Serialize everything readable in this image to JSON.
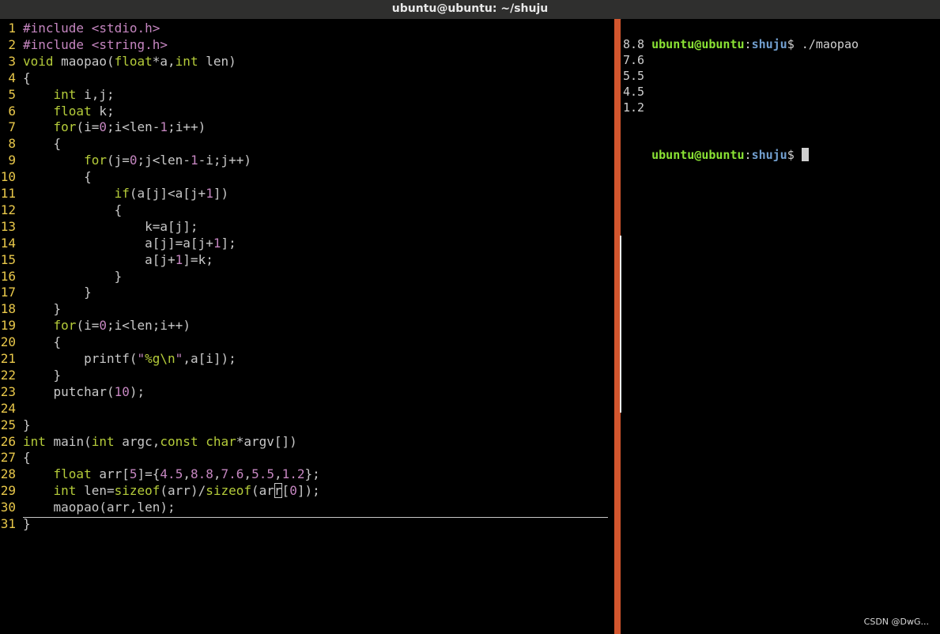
{
  "window": {
    "title": "ubuntu@ubuntu: ~/shuju"
  },
  "colors": {
    "line_number": "#e9c84a",
    "preproc": "#c586c0",
    "type_keyword": "#b5cc3a",
    "number": "#c586c0",
    "default_text": "#c8c8c8",
    "string": "#c586c0",
    "prompt_user": "#8ae234",
    "prompt_path": "#729fcf",
    "divider": "#d2562e"
  },
  "editor": {
    "lines": [
      {
        "num": "1",
        "tokens": [
          [
            "#include ",
            "pp"
          ],
          [
            "<stdio.h>",
            "st"
          ]
        ]
      },
      {
        "num": "2",
        "tokens": [
          [
            "#include ",
            "pp"
          ],
          [
            "<string.h>",
            "st"
          ]
        ]
      },
      {
        "num": "3",
        "tokens": [
          [
            "void",
            "ty"
          ],
          [
            " maopao(",
            "df"
          ],
          [
            "float",
            "ty"
          ],
          [
            "*a,",
            "df"
          ],
          [
            "int",
            "ty"
          ],
          [
            " len)",
            "df"
          ]
        ]
      },
      {
        "num": "4",
        "tokens": [
          [
            "{",
            "df"
          ]
        ]
      },
      {
        "num": "5",
        "tokens": [
          [
            "    ",
            "df"
          ],
          [
            "int",
            "ty"
          ],
          [
            " i,j;",
            "df"
          ]
        ]
      },
      {
        "num": "6",
        "tokens": [
          [
            "    ",
            "df"
          ],
          [
            "float",
            "ty"
          ],
          [
            " k;",
            "df"
          ]
        ]
      },
      {
        "num": "7",
        "tokens": [
          [
            "    ",
            "df"
          ],
          [
            "for",
            "ty"
          ],
          [
            "(i=",
            "df"
          ],
          [
            "0",
            "nu"
          ],
          [
            ";i<len-",
            "df"
          ],
          [
            "1",
            "nu"
          ],
          [
            ";i++)",
            "df"
          ]
        ]
      },
      {
        "num": "8",
        "tokens": [
          [
            "    {",
            "df"
          ]
        ]
      },
      {
        "num": "9",
        "tokens": [
          [
            "        ",
            "df"
          ],
          [
            "for",
            "ty"
          ],
          [
            "(j=",
            "df"
          ],
          [
            "0",
            "nu"
          ],
          [
            ";j<len-",
            "df"
          ],
          [
            "1",
            "nu"
          ],
          [
            "-i;j++)",
            "df"
          ]
        ]
      },
      {
        "num": "10",
        "tokens": [
          [
            "        {",
            "df"
          ]
        ]
      },
      {
        "num": "11",
        "tokens": [
          [
            "            ",
            "df"
          ],
          [
            "if",
            "ty"
          ],
          [
            "(a[j]<a[j+",
            "df"
          ],
          [
            "1",
            "nu"
          ],
          [
            "])",
            "df"
          ]
        ]
      },
      {
        "num": "12",
        "tokens": [
          [
            "            {",
            "df"
          ]
        ]
      },
      {
        "num": "13",
        "tokens": [
          [
            "                k=a[j];",
            "df"
          ]
        ]
      },
      {
        "num": "14",
        "tokens": [
          [
            "                a[j]=a[j+",
            "df"
          ],
          [
            "1",
            "nu"
          ],
          [
            "];",
            "df"
          ]
        ]
      },
      {
        "num": "15",
        "tokens": [
          [
            "                a[j+",
            "df"
          ],
          [
            "1",
            "nu"
          ],
          [
            "]=k;",
            "df"
          ]
        ]
      },
      {
        "num": "16",
        "tokens": [
          [
            "            }",
            "df"
          ]
        ]
      },
      {
        "num": "17",
        "tokens": [
          [
            "        }",
            "df"
          ]
        ]
      },
      {
        "num": "18",
        "tokens": [
          [
            "    }",
            "df"
          ]
        ]
      },
      {
        "num": "19",
        "tokens": [
          [
            "    ",
            "df"
          ],
          [
            "for",
            "ty"
          ],
          [
            "(i=",
            "df"
          ],
          [
            "0",
            "nu"
          ],
          [
            ";i<len;i++)",
            "df"
          ]
        ]
      },
      {
        "num": "20",
        "tokens": [
          [
            "    {",
            "df"
          ]
        ]
      },
      {
        "num": "21",
        "tokens": [
          [
            "        printf(",
            "df"
          ],
          [
            "\"",
            "st"
          ],
          [
            "%g\\n",
            "ty"
          ],
          [
            "\"",
            "st"
          ],
          [
            ",a[i]);",
            "df"
          ]
        ]
      },
      {
        "num": "22",
        "tokens": [
          [
            "    }",
            "df"
          ]
        ]
      },
      {
        "num": "23",
        "tokens": [
          [
            "    putchar(",
            "df"
          ],
          [
            "10",
            "nu"
          ],
          [
            ");",
            "df"
          ]
        ]
      },
      {
        "num": "24",
        "tokens": [
          [
            "",
            "df"
          ]
        ]
      },
      {
        "num": "25",
        "tokens": [
          [
            "}",
            "df"
          ]
        ]
      },
      {
        "num": "26",
        "tokens": [
          [
            "int",
            "ty"
          ],
          [
            " main(",
            "df"
          ],
          [
            "int",
            "ty"
          ],
          [
            " argc,",
            "df"
          ],
          [
            "const",
            "ty"
          ],
          [
            " ",
            "df"
          ],
          [
            "char",
            "ty"
          ],
          [
            "*argv[])",
            "df"
          ]
        ]
      },
      {
        "num": "27",
        "tokens": [
          [
            "{",
            "df"
          ]
        ]
      },
      {
        "num": "28",
        "tokens": [
          [
            "    ",
            "df"
          ],
          [
            "float",
            "ty"
          ],
          [
            " arr[",
            "df"
          ],
          [
            "5",
            "nu"
          ],
          [
            "]={",
            "df"
          ],
          [
            "4.5",
            "nu"
          ],
          [
            ",",
            "df"
          ],
          [
            "8.8",
            "nu"
          ],
          [
            ",",
            "df"
          ],
          [
            "7.6",
            "nu"
          ],
          [
            ",",
            "df"
          ],
          [
            "5.5",
            "nu"
          ],
          [
            ",",
            "df"
          ],
          [
            "1.2",
            "nu"
          ],
          [
            "};",
            "df"
          ]
        ]
      },
      {
        "num": "29",
        "tokens": [
          [
            "    ",
            "df"
          ],
          [
            "int",
            "ty"
          ],
          [
            " len=",
            "df"
          ],
          [
            "sizeof",
            "ty"
          ],
          [
            "(arr)/",
            "df"
          ],
          [
            "sizeof",
            "ty"
          ],
          [
            "(ar",
            "df"
          ],
          [
            "r",
            "cu"
          ],
          [
            "[",
            "df"
          ],
          [
            "0",
            "nu"
          ],
          [
            "]);",
            "df"
          ]
        ]
      },
      {
        "num": "30",
        "tokens": [
          [
            "    maopao(arr,len);",
            "df"
          ]
        ]
      },
      {
        "num": "31",
        "tokens": [
          [
            "}",
            "df"
          ]
        ]
      }
    ]
  },
  "terminal": {
    "prompt_user": "ubuntu@ubuntu",
    "prompt_sep": ":",
    "prompt_path": "shuju",
    "prompt_suffix": "$ ",
    "command": "./maopao",
    "output": [
      "8.8",
      "7.6",
      "5.5",
      "4.5",
      "1.2",
      ""
    ]
  },
  "watermark": "CSDN @DwG..."
}
